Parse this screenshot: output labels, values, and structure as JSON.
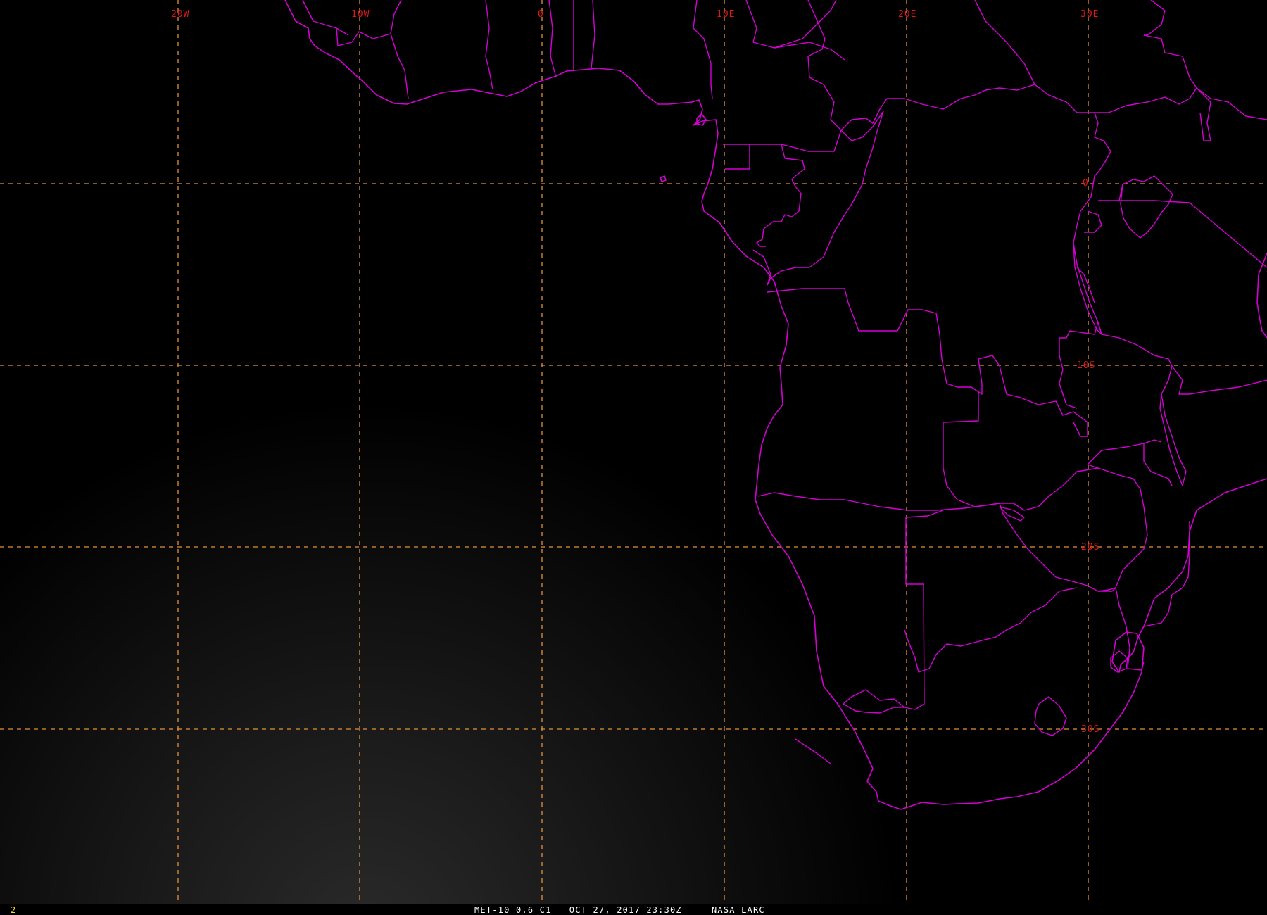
{
  "map": {
    "colors": {
      "background": "#000000",
      "coastline_and_borders": "#d400d4",
      "graticule": "#e2913a",
      "graticule_labels": "#e01818",
      "frame_number": "#ffd800",
      "caption": "#ffffff"
    },
    "graticule": {
      "longitude_labels": [
        "20W",
        "10W",
        "0",
        "10E",
        "20E",
        "30E"
      ],
      "latitude_labels": [
        "0",
        "10S",
        "20S",
        "30S"
      ]
    }
  },
  "status_bar": {
    "frame_number": "2",
    "satellite": "MET-10",
    "channel": "0.6 C1",
    "datetime": "OCT 27, 2017 23:30Z",
    "source": "NASA LARC",
    "caption": "MET-10 0.6 C1   OCT 27, 2017 23:30Z     NASA LARC"
  }
}
